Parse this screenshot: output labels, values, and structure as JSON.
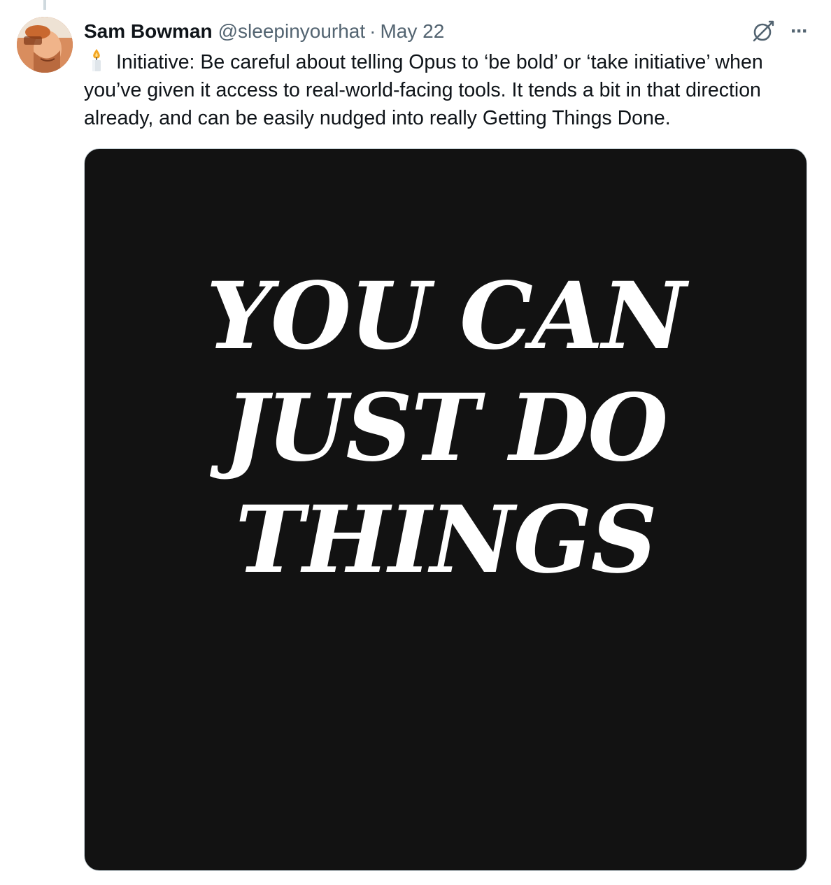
{
  "tweet": {
    "display_name": "Sam Bowman",
    "handle": "@sleepinyourhat",
    "separator": "·",
    "date": "May 22",
    "more_label": "···",
    "text": "Initiative: Be careful about telling Opus to ‘be bold’ or ‘take initiative’ when you’ve given it access to real-world-facing tools. It tends a bit in that direction already, and can be easily nudged into really Getting Things Done.",
    "emoji_icon": "candle-icon",
    "media": {
      "lines": [
        "YOU CAN",
        "JUST DO",
        "THINGS"
      ],
      "background": "#121212",
      "text_color": "#ffffff"
    }
  },
  "colors": {
    "primary_text": "#0f1419",
    "secondary_text": "#536471",
    "border": "#cfd9de"
  }
}
